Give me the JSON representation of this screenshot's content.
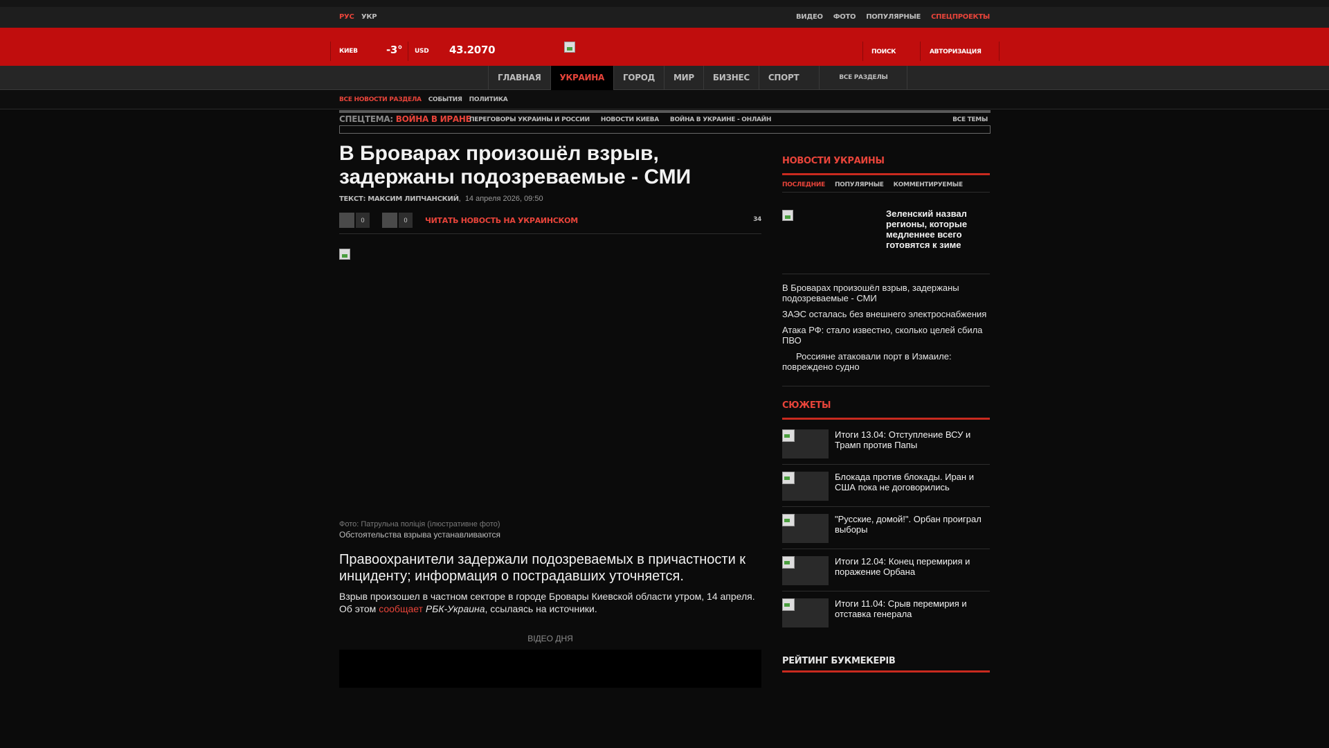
{
  "topbar": {
    "lang_rus": "РУС",
    "lang_ukr": "УКР",
    "links": [
      "ВИДЕО",
      "ФОТО",
      "ПОПУЛЯРНЫЕ",
      "СПЕЦПРОЕКТЫ"
    ]
  },
  "header": {
    "city": "КИЕВ",
    "temperature": "-3°",
    "currency": "USD",
    "rate": "43.2070",
    "search": "ПОИСК",
    "login": "АВТОРИЗАЦИЯ"
  },
  "nav": {
    "items": [
      "ГЛАВНАЯ",
      "УКРАИНА",
      "ГОРОД",
      "МИР",
      "БИЗНЕС",
      "СПОРТ"
    ],
    "active": "УКРАИНА",
    "all": "ВСЕ РАЗДЕЛЫ"
  },
  "subnav": [
    "ВСЕ НОВОСТИ РАЗДЕЛА",
    "СОБЫТИЯ",
    "ПОЛИТИКА"
  ],
  "special": {
    "label": "СПЕЦТЕМА:",
    "topic": "ВОЙНА В ИРАНЕ",
    "links": [
      "ПЕРЕГОВОРЫ УКРАИНЫ И РОССИИ",
      "НОВОСТИ КИЕВА",
      "ВОЙНА В УКРАИНЕ - ОНЛАЙН"
    ],
    "all": "ВСЕ ТЕМЫ"
  },
  "article": {
    "headline": "В Броварах произошёл взрыв, задержаны подозреваемые - СМИ",
    "byline_prefix": "ТЕКСТ:",
    "author": "МАКСИМ ЛИПЧАНСКИЙ",
    "date": "14 апреля 2026, 09:50",
    "share_count_1": "0",
    "share_count_2": "0",
    "read_ua": "ЧИТАТЬ НОВОСТЬ НА УКРАИНСКОМ",
    "comments": "34",
    "photo_credit": "Фото: Патрульна поліція (ілюстративне фото)",
    "photo_caption": "Обстоятельства взрыва устанавливаются",
    "lead": "Правоохранители задержали подозреваемых в причастности к инциденту; информация о пострадавших уточняется.",
    "body_part1": "Взрыв произошел в частном секторе в городе Бровары Киевской области утром, 14 апреля. Об этом ",
    "body_link": "сообщает",
    "body_source": "РБК-Украина",
    "body_part2": ", ссылаясь на источники.",
    "video_label": "ВІДЕО ДНЯ"
  },
  "sidebar": {
    "news_title": "НОВОСТИ УКРАИНЫ",
    "tabs": [
      "ПОСЛЕДНИЕ",
      "ПОПУЛЯРНЫЕ",
      "КОММЕНТИРУЕМЫЕ"
    ],
    "featured": "Зеленский назвал регионы, которые медленнее всего готовятся к зиме",
    "news": [
      "В Броварах произошёл взрыв, задержаны подозреваемые - СМИ",
      "ЗАЭС осталась без внешнего электроснабжения",
      "Атака РФ: стало известно, сколько целей сбила ПВО",
      "Россияне атаковали порт в Измаиле: повреждено судно"
    ],
    "stories_title": "СЮЖЕТЫ",
    "stories": [
      "Итоги 13.04: Отступление ВСУ и Трамп против Папы",
      "Блокада против блокады. Иран и США пока не договорились",
      "\"Русские, домой!\". Орбан проиграл выборы",
      "Итоги 12.04: Конец перемирия и поражение Орбана",
      "Итоги 11.04: Срыв перемирия и отставка генерала"
    ],
    "rating_title": "РЕЙТИНГ БУКМЕКЕРІВ"
  },
  "colors": {
    "brand_red": "#c00d0d",
    "accent": "#e8443a",
    "background": "#0b0b0b"
  }
}
